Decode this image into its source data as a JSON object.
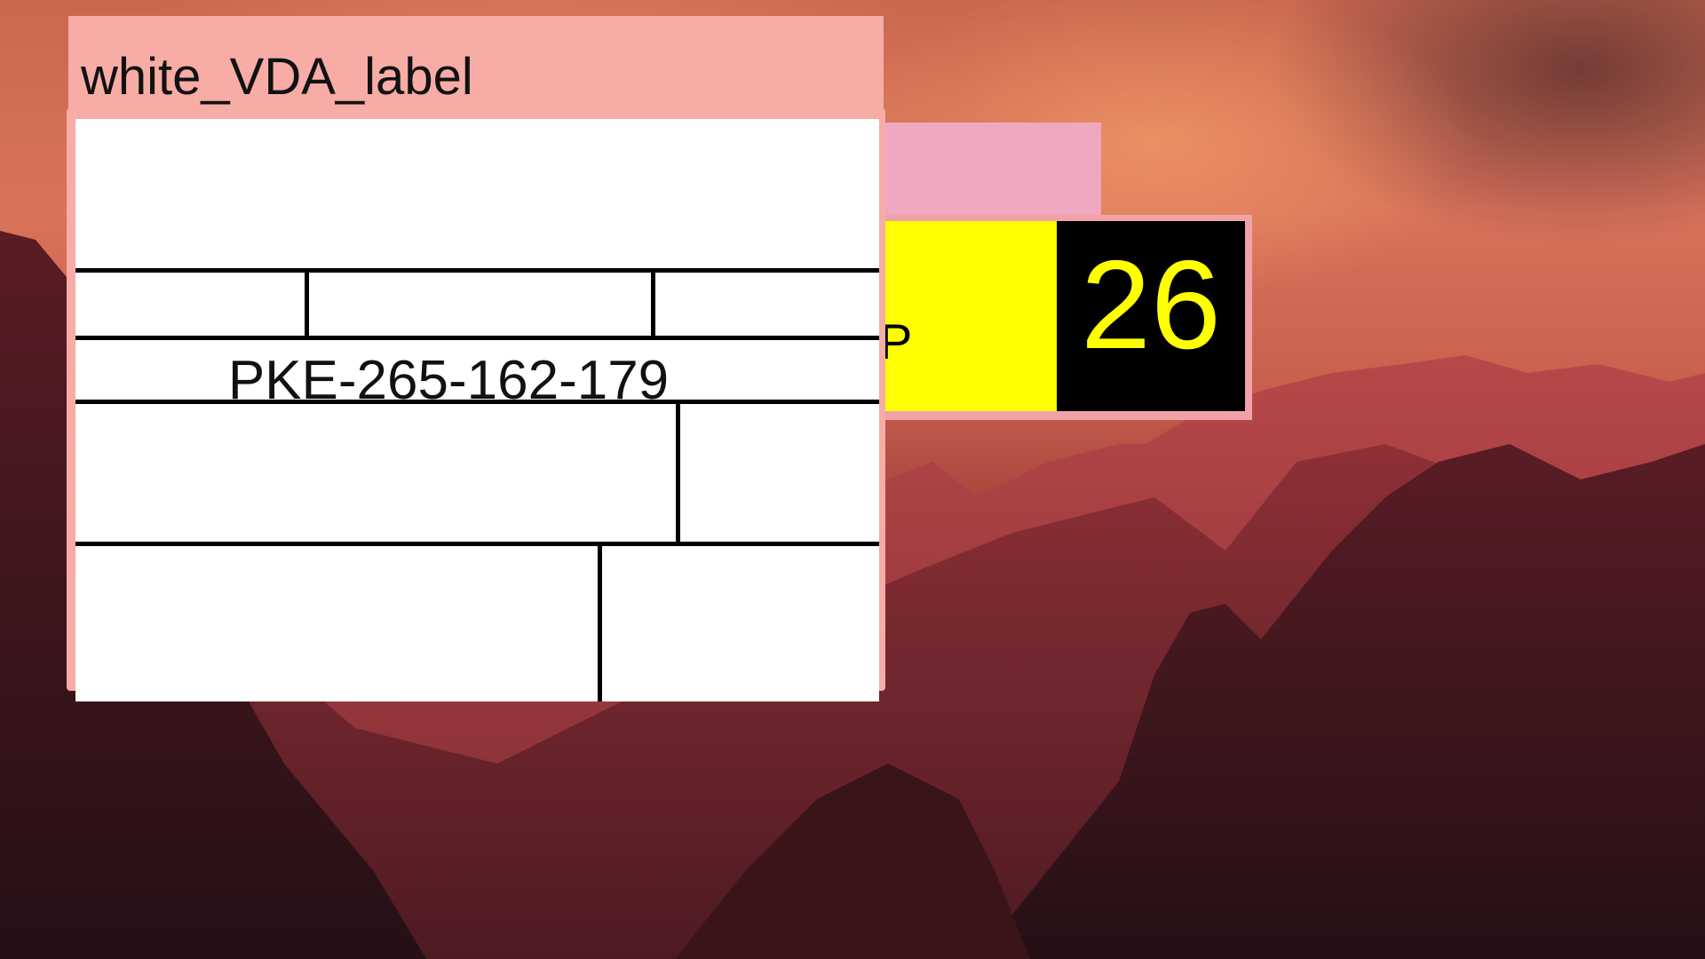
{
  "background_window": {
    "yellow_text": "P",
    "number": "26",
    "colors": {
      "title_bar": "#efa8c0",
      "frame": "#f0a2a8",
      "left_panel": "#ffff00",
      "right_panel": "#000000",
      "number_text": "#ffff00"
    }
  },
  "label_window": {
    "title": "white_VDA_label",
    "serial": "PKE-265-162-179",
    "colors": {
      "title_bar": "#f7aca6",
      "label_background": "#ffffff",
      "grid_lines": "#000000"
    }
  },
  "wallpaper": {
    "description_icon": "mountain-sunset-wallpaper"
  }
}
